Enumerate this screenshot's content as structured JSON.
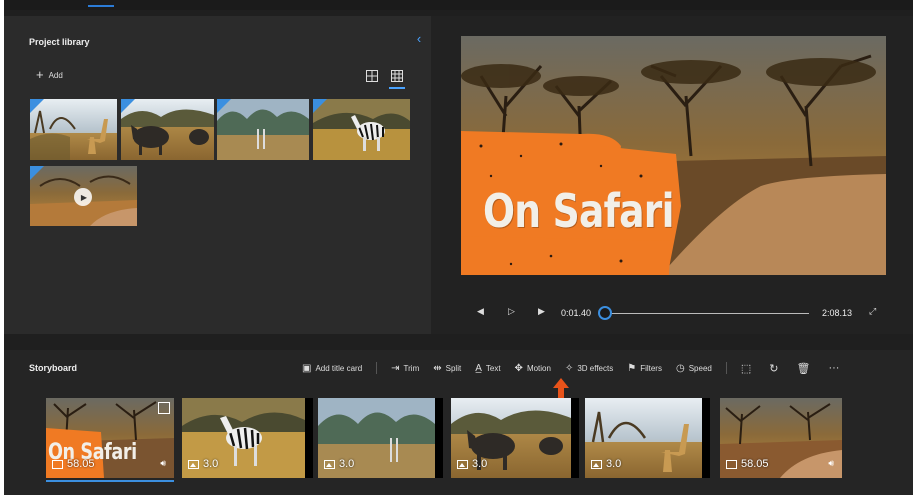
{
  "colors": {
    "accent": "#3b8fe0",
    "panel": "#2b2b2b",
    "background": "#1f1f1f",
    "arrow": "#e8531a",
    "title_paint": "#f07a23"
  },
  "library": {
    "title": "Project library",
    "add_label": "Add",
    "collapse_icon": "chevron-left-icon",
    "view_large_icon": "grid-large-icon",
    "view_small_icon": "grid-small-icon"
  },
  "preview": {
    "video_title": "On Safari",
    "current_time": "0:01.40",
    "total_time": "2:08.13",
    "progress_fraction": 0.01
  },
  "storyboard": {
    "title": "Storyboard",
    "toolbar": {
      "add_title_card": "Add title card",
      "trim": "Trim",
      "split": "Split",
      "text": "Text",
      "motion": "Motion",
      "effects_3d": "3D effects",
      "filters": "Filters",
      "speed": "Speed",
      "more": "···"
    },
    "clips": [
      {
        "duration": "58.05",
        "title": "On Safari",
        "kind": "video",
        "audio": true
      },
      {
        "duration": "3.0",
        "kind": "image"
      },
      {
        "duration": "3.0",
        "kind": "image"
      },
      {
        "duration": "3.0",
        "kind": "image"
      },
      {
        "duration": "3.0",
        "kind": "image"
      },
      {
        "duration": "58.05",
        "kind": "video",
        "audio": true
      }
    ]
  }
}
